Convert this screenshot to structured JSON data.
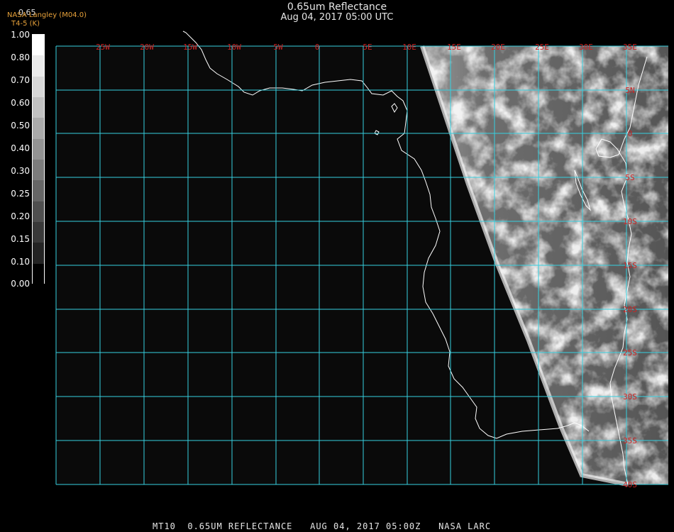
{
  "title": "0.65um Reflectance",
  "subtitle": "Aug 04, 2017 05:00 UTC",
  "credit": {
    "line1": "NASA Langley (M04.0)",
    "line2": "T4-5 (K)"
  },
  "colorbar_top_value": "0.65",
  "colorbar": {
    "labels": [
      "1.00",
      "0.80",
      "0.70",
      "0.60",
      "0.50",
      "0.40",
      "0.30",
      "0.25",
      "0.20",
      "0.15",
      "0.10",
      "0.00"
    ]
  },
  "map": {
    "lon_labels": [
      "25W",
      "20W",
      "15W",
      "10W",
      "5W",
      "0",
      "5E",
      "10E",
      "15E",
      "20E",
      "25E",
      "30E",
      "35E"
    ],
    "lat_labels": [
      "5N",
      "0",
      "5S",
      "10S",
      "15S",
      "20S",
      "25S",
      "30S",
      "35S",
      "40S"
    ],
    "colors": {
      "background": "#000000",
      "map_fill": "#0a0a0a",
      "grid": "#36d0e0",
      "labels": "#cc2222",
      "coast": "#ffffff"
    }
  },
  "footer": {
    "product": "MT10",
    "channel": "0.65UM REFLECTANCE",
    "datetime": "AUG 04, 2017 05:00Z",
    "source": "NASA LARC"
  }
}
